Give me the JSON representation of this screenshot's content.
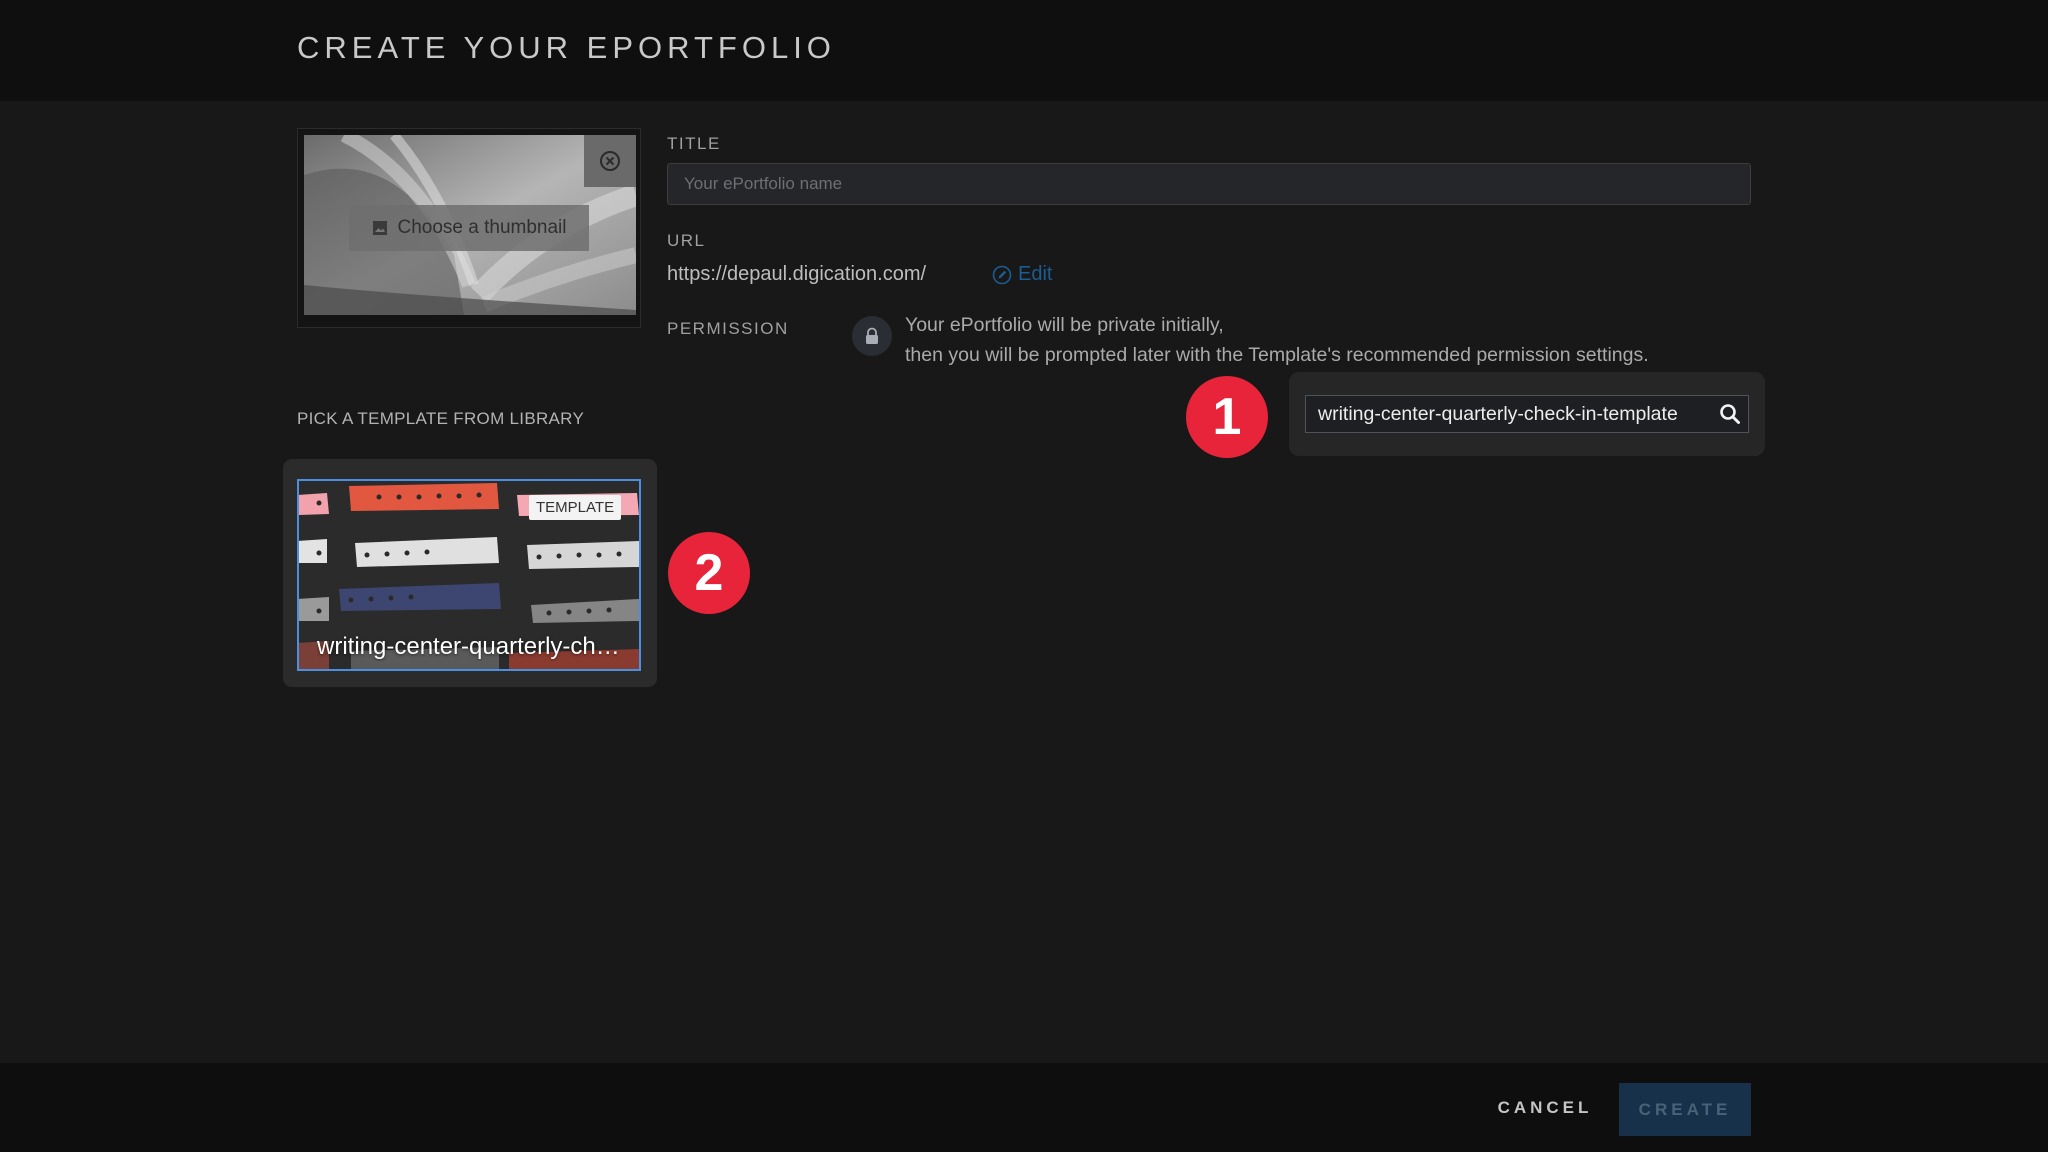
{
  "header": {
    "title": "CREATE YOUR EPORTFOLIO"
  },
  "thumbnail": {
    "choose_label": "Choose a thumbnail"
  },
  "form": {
    "title_label": "TITLE",
    "title_placeholder": "Your ePortfolio name",
    "title_value": "",
    "url_label": "URL",
    "url_value": "https://depaul.digication.com/",
    "edit_label": "Edit",
    "permission_label": "PERMISSION",
    "permission_line1": "Your ePortfolio will be private initially,",
    "permission_line2": "then you will be prompted later with the Template's recommended permission settings."
  },
  "library": {
    "label": "PICK A TEMPLATE FROM LIBRARY",
    "search_value": "writing-center-quarterly-check-in-template",
    "templates": [
      {
        "tag": "TEMPLATE",
        "title": "writing-center-quarterly-check-in-template"
      }
    ]
  },
  "badges": [
    "1",
    "2"
  ],
  "footer": {
    "cancel_label": "CANCEL",
    "create_label": "CREATE"
  },
  "colors": {
    "accent_badge": "#e8243b",
    "card_border": "#4a8fe0",
    "edit_link": "#1b5c93",
    "create_bg": "#17314a"
  }
}
